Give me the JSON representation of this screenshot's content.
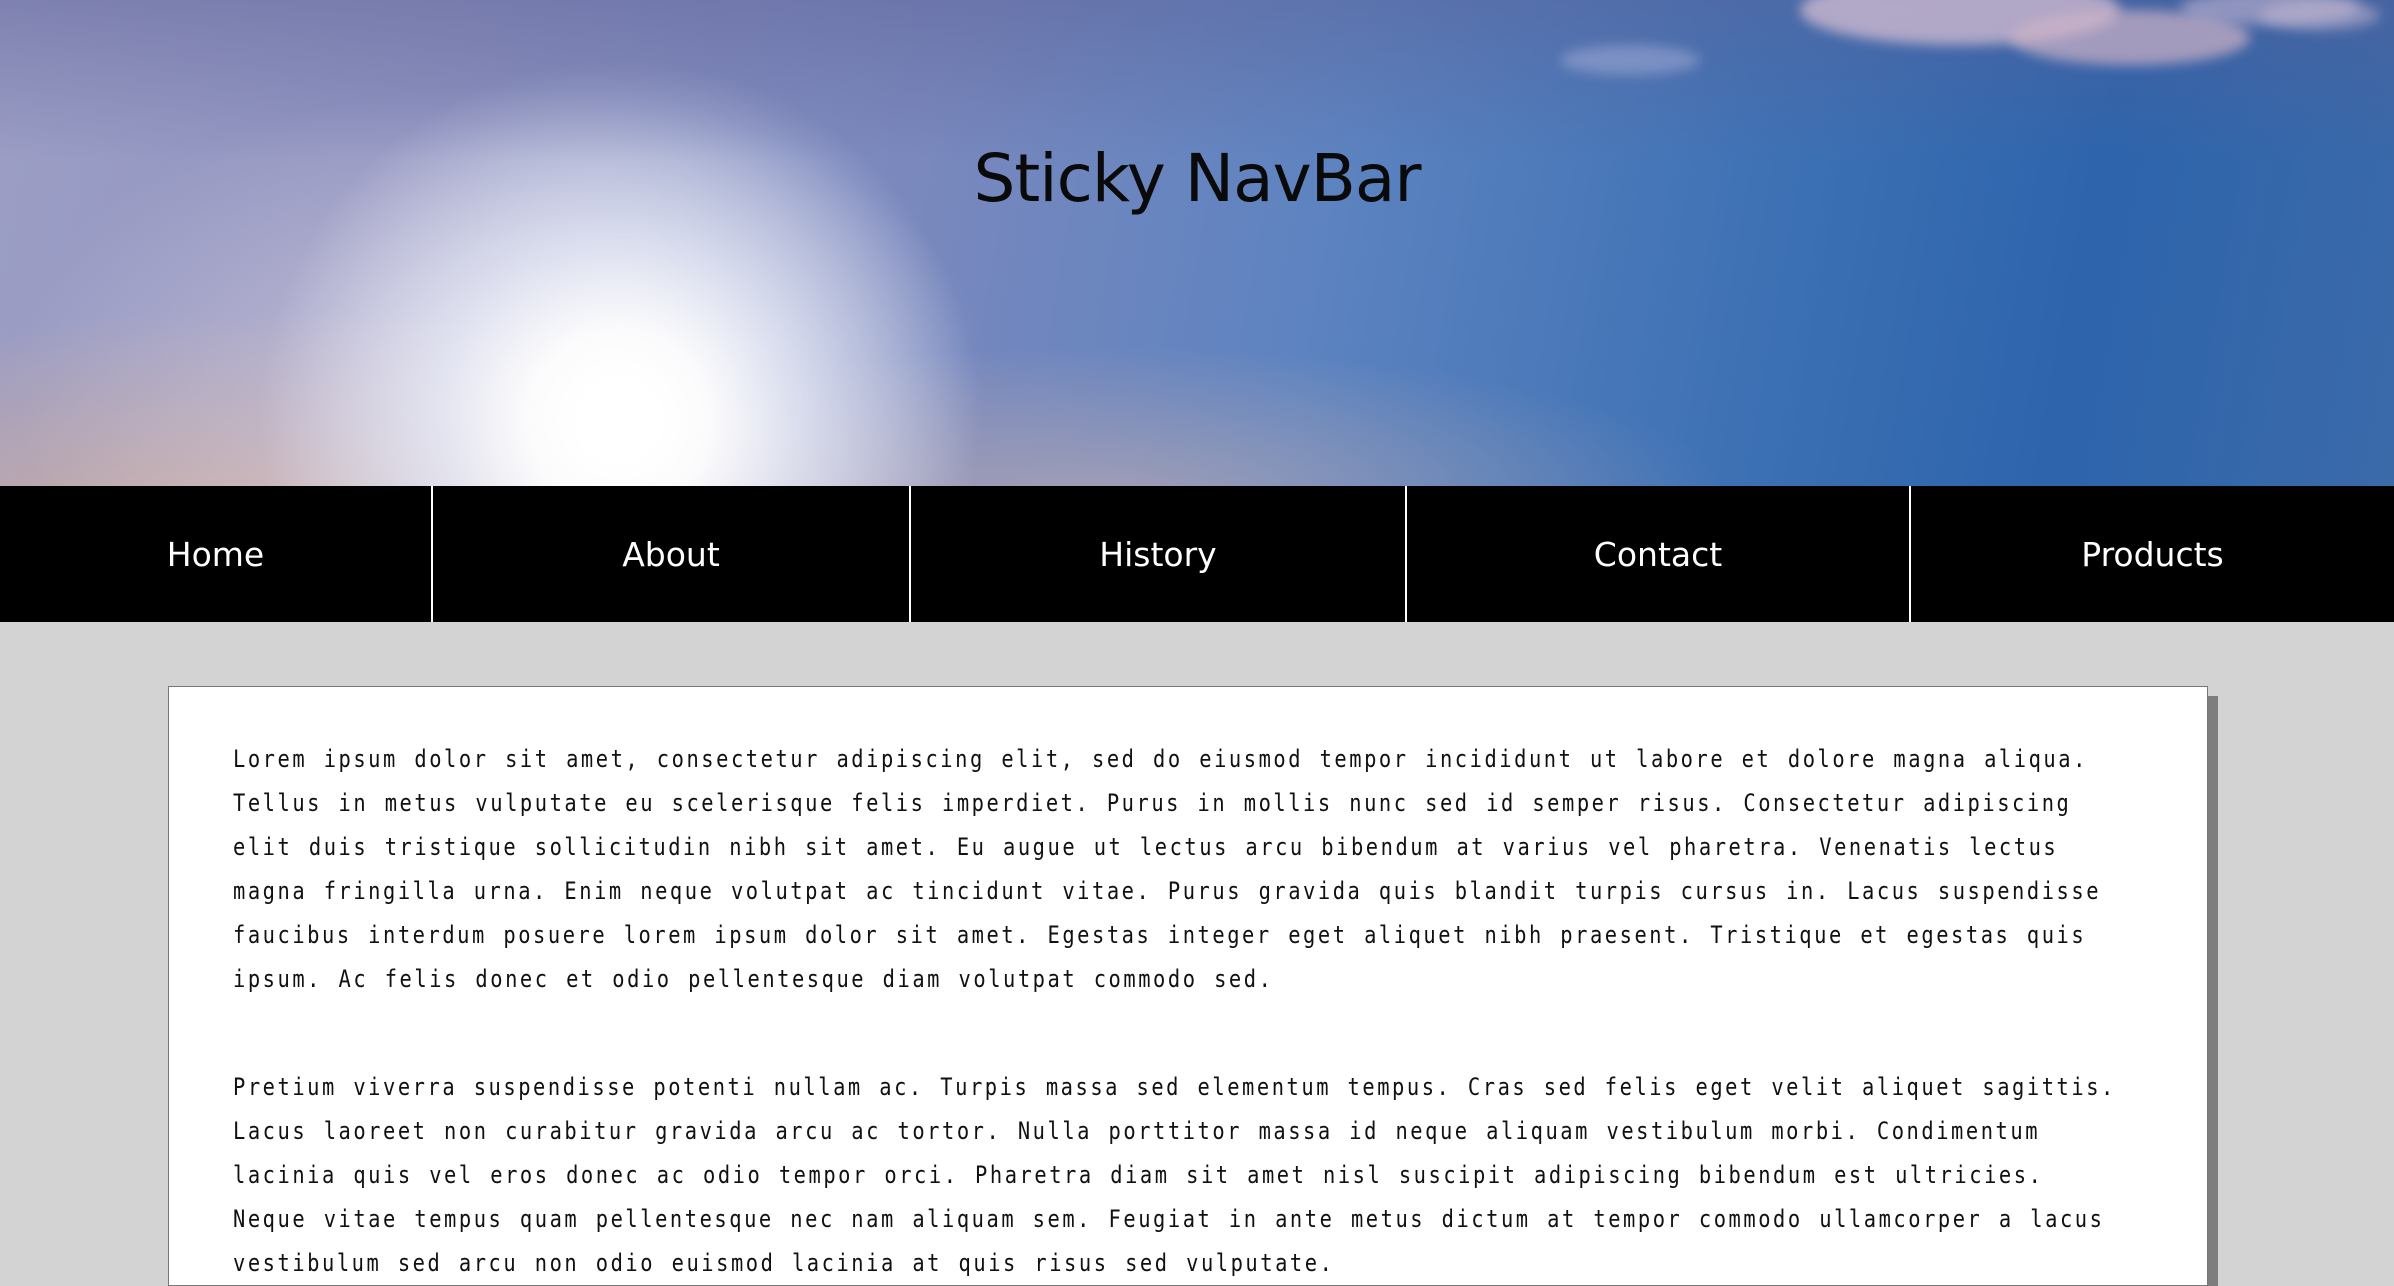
{
  "hero": {
    "title": "Sticky NavBar"
  },
  "nav": {
    "items": [
      {
        "label": "Home"
      },
      {
        "label": "About"
      },
      {
        "label": "History"
      },
      {
        "label": "Contact"
      },
      {
        "label": "Products"
      }
    ]
  },
  "content": {
    "paragraphs": [
      "Lorem ipsum dolor sit amet, consectetur adipiscing elit, sed do eiusmod tempor incididunt ut labore et dolore magna aliqua. Tellus in metus vulputate eu scelerisque felis imperdiet. Purus in mollis nunc sed id semper risus. Consectetur adipiscing elit duis tristique sollicitudin nibh sit amet. Eu augue ut lectus arcu bibendum at varius vel pharetra. Venenatis lectus magna fringilla urna. Enim neque volutpat ac tincidunt vitae. Purus gravida quis blandit turpis cursus in. Lacus suspendisse faucibus interdum posuere lorem ipsum dolor sit amet. Egestas integer eget aliquet nibh praesent. Tristique et egestas quis ipsum. Ac felis donec et odio pellentesque diam volutpat commodo sed.",
      "Pretium viverra suspendisse potenti nullam ac. Turpis massa sed elementum tempus. Cras sed felis eget velit aliquet sagittis. Lacus laoreet non curabitur gravida arcu ac tortor. Nulla porttitor massa id neque aliquam vestibulum morbi. Condimentum lacinia quis vel eros donec ac odio tempor orci. Pharetra diam sit amet nisl suscipit adipiscing bibendum est ultricies. Neque vitae tempus quam pellentesque nec nam aliquam sem. Feugiat in ante metus dictum at tempor commodo ullamcorper a lacus vestibulum sed arcu non odio euismod lacinia at quis risus sed vulputate."
    ]
  }
}
